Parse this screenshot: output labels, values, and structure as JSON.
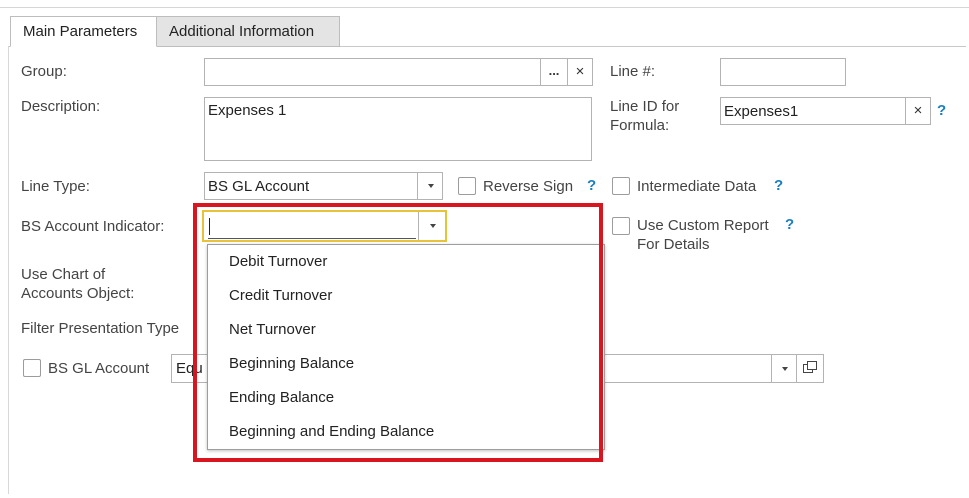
{
  "tabs": [
    {
      "label": "Main Parameters"
    },
    {
      "label": "Additional Information"
    }
  ],
  "group": {
    "label": "Group:",
    "value": "",
    "browse_label": "...",
    "clear_label": "×"
  },
  "line_no": {
    "label": "Line #:",
    "value": ""
  },
  "description": {
    "label": "Description:",
    "value": "Expenses 1"
  },
  "line_id": {
    "label_line1": "Line ID for",
    "label_line2": "Formula:",
    "value": "Expenses1",
    "clear_label": "×",
    "help": "?"
  },
  "line_type": {
    "label": "Line Type:",
    "value": "BS GL Account"
  },
  "reverse_sign": {
    "label": "Reverse Sign",
    "checked": false,
    "help": "?"
  },
  "intermediate_data": {
    "label": "Intermediate Data",
    "checked": false,
    "help": "?"
  },
  "bs_account_indicator": {
    "label": "BS Account Indicator:",
    "value": ""
  },
  "use_custom_report": {
    "label_line1": "Use Custom Report",
    "label_line2": "For Details",
    "checked": false,
    "help": "?"
  },
  "use_chart": {
    "label_line1": "Use Chart of",
    "label_line2": "Accounts Object:"
  },
  "filter_presentation": {
    "label": "Filter Presentation Type"
  },
  "bs_gl_account": {
    "label": "BS GL Account",
    "checked": false,
    "value": "Equ"
  },
  "dropdown": {
    "options": [
      "Debit Turnover",
      "Credit Turnover",
      "Net Turnover",
      "Beginning Balance",
      "Ending Balance",
      "Beginning and Ending Balance"
    ]
  },
  "colors": {
    "highlight": "#d9161f",
    "focus": "#e8c33a",
    "help": "#1a7fbf"
  }
}
